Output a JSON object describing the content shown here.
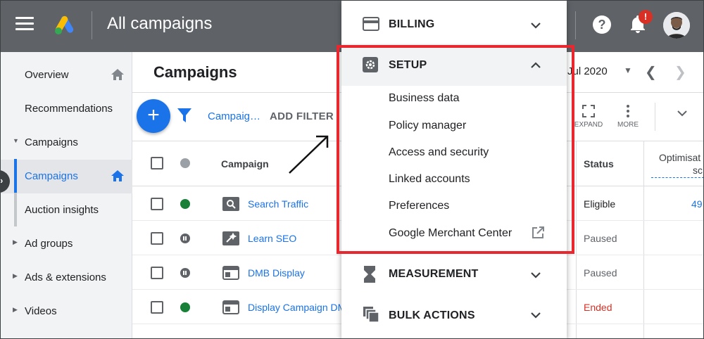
{
  "app": {
    "title": "All campaigns"
  },
  "topbar": {
    "notification_count": "!"
  },
  "sidebar": {
    "items": [
      {
        "label": "Overview"
      },
      {
        "label": "Recommendations"
      },
      {
        "label": "Campaigns"
      },
      {
        "label": "Campaigns"
      },
      {
        "label": "Auction insights"
      },
      {
        "label": "Ad groups"
      },
      {
        "label": "Ads & extensions"
      },
      {
        "label": "Videos"
      }
    ]
  },
  "main": {
    "title": "Campaigns",
    "date_range": "Jul 2020",
    "filter_chip": "Campaig…",
    "add_filter": "ADD FILTER",
    "tools": {
      "expand": "EXPAND",
      "more": "MORE"
    }
  },
  "table": {
    "headers": {
      "campaign": "Campaign",
      "status": "Status",
      "optimisation": "Optimisat",
      "optimisation_line2": "sc"
    },
    "rows": [
      {
        "campaign": "Search Traffic",
        "status": "Eligible",
        "score": "49"
      },
      {
        "campaign": "Learn SEO",
        "status": "Paused",
        "score": ""
      },
      {
        "campaign": "DMB Display",
        "status": "Paused",
        "score": ""
      },
      {
        "campaign": "Display Campaign DM",
        "status": "Ended",
        "score": ""
      }
    ]
  },
  "menu": {
    "billing": "BILLING",
    "setup": "SETUP",
    "setup_items": [
      "Business data",
      "Policy manager",
      "Access and security",
      "Linked accounts",
      "Preferences",
      "Google Merchant Center"
    ],
    "measurement": "MEASUREMENT",
    "bulk_actions": "BULK ACTIONS"
  },
  "colors": {
    "accent": "#1a73e8",
    "highlight": "#e8282e",
    "topbar": "#5f6368",
    "ended": "#d93025"
  }
}
